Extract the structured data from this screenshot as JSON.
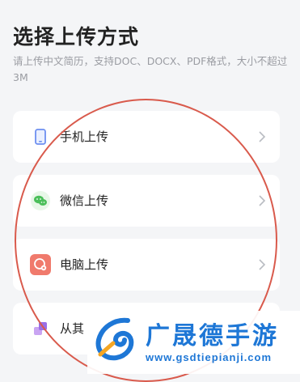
{
  "header": {
    "title": "选择上传方式",
    "description": "请上传中文简历，支持DOC、DOCX、PDF格式，大小不超过3M"
  },
  "options": [
    {
      "label": "手机上传",
      "icon": "phone-icon"
    },
    {
      "label": "微信上传",
      "icon": "wechat-icon"
    },
    {
      "label": "电脑上传",
      "icon": "computer-icon"
    },
    {
      "label": "从其",
      "icon": "other-upload-icon"
    }
  ],
  "watermark": {
    "name": "广晟德手游",
    "url": "www.gsdtiepianji.com"
  },
  "colors": {
    "annotation": "#d95a4c",
    "watermark": "#1e77d6"
  }
}
